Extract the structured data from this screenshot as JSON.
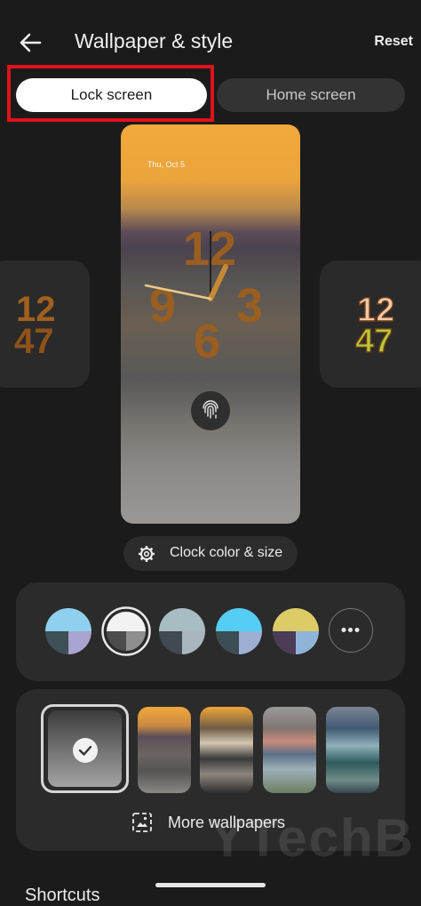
{
  "header": {
    "title": "Wallpaper & style",
    "reset_label": "Reset",
    "back_icon": "arrow-left-icon"
  },
  "tabs": {
    "lock": "Lock screen",
    "home": "Home screen",
    "selected": "Lock screen"
  },
  "preview": {
    "date": "Thu, Oct 5",
    "clock_digits": [
      "12",
      "9",
      "3",
      "6"
    ],
    "fingerprint_icon": "fingerprint-icon"
  },
  "side_previews": {
    "left_digits": [
      "12",
      "47"
    ],
    "right_digits": [
      "12",
      "47"
    ]
  },
  "clock_button": {
    "label": "Clock color & size",
    "icon": "gear-icon"
  },
  "color_options": [
    {
      "top": "#8fd0ee",
      "bl": "#3e4f55",
      "br": "#a9a3cf"
    },
    {
      "top": "#f2f2f2",
      "bl": "#4c4c4c",
      "br": "#8e8e8e"
    },
    {
      "top": "#a8bcc4",
      "bl": "#404a50",
      "br": "#a9b6be"
    },
    {
      "top": "#55cdf5",
      "bl": "#3d4d55",
      "br": "#9cb0d4"
    },
    {
      "top": "#dccc68",
      "bl": "#4b3c57",
      "br": "#8fb4d8"
    }
  ],
  "selected_color_index": 1,
  "wallpapers": {
    "more_label": "More wallpapers",
    "more_icon": "image-icon"
  },
  "section": {
    "shortcuts": "Shortcuts"
  },
  "watermark": "YTechB",
  "colors": {
    "accent_red": "#e0121b",
    "background": "#1b1b1b",
    "card": "#2b2b2b",
    "clock_brown": "#9a5e20"
  }
}
